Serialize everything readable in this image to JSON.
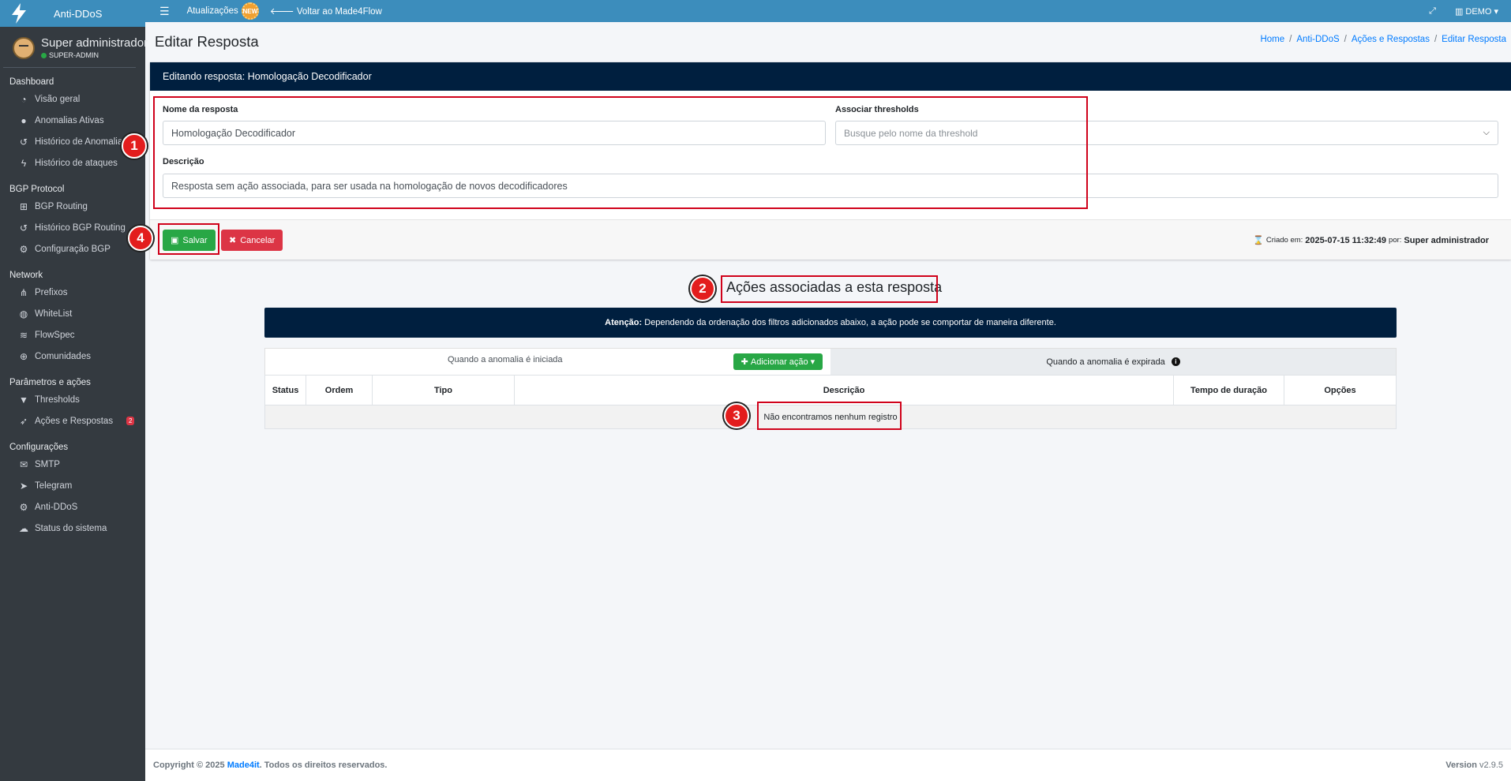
{
  "app": {
    "brand": "Anti-DDoS"
  },
  "user": {
    "name": "Super administrador",
    "role": "SUPER-ADMIN"
  },
  "sidebar": {
    "sections": [
      {
        "title": "Dashboard",
        "items": [
          {
            "label": "Visão geral",
            "icon": "dashboard-icon"
          },
          {
            "label": "Anomalias Ativas",
            "icon": "exclamation-icon"
          },
          {
            "label": "Histórico de Anomalias",
            "icon": "history-icon"
          },
          {
            "label": "Histórico de ataques",
            "icon": "bolt-icon"
          }
        ]
      },
      {
        "title": "BGP Protocol",
        "items": [
          {
            "label": "BGP Routing",
            "icon": "sitemap-icon"
          },
          {
            "label": "Histórico BGP Routing",
            "icon": "history-icon"
          },
          {
            "label": "Configuração BGP",
            "icon": "gear-icon"
          }
        ]
      },
      {
        "title": "Network",
        "items": [
          {
            "label": "Prefixos",
            "icon": "network-icon"
          },
          {
            "label": "WhiteList",
            "icon": "shield-icon"
          },
          {
            "label": "FlowSpec",
            "icon": "wifi-icon"
          },
          {
            "label": "Comunidades",
            "icon": "globe-icon"
          }
        ]
      },
      {
        "title": "Parâmetros e ações",
        "items": [
          {
            "label": "Thresholds",
            "icon": "filter-icon"
          },
          {
            "label": "Ações e Respostas",
            "icon": "rocket-icon",
            "badge": "2"
          }
        ]
      },
      {
        "title": "Configurações",
        "items": [
          {
            "label": "SMTP",
            "icon": "envelope-icon"
          },
          {
            "label": "Telegram",
            "icon": "telegram-icon"
          },
          {
            "label": "Anti-DDoS",
            "icon": "gears-icon"
          },
          {
            "label": "Status do sistema",
            "icon": "cloud-icon"
          }
        ]
      }
    ]
  },
  "topbar": {
    "updates_label": "Atualizações",
    "updates_badge": "NEW",
    "back_label": "Voltar ao Made4Flow",
    "company_label": "DEMO"
  },
  "header": {
    "title": "Editar Resposta",
    "breadcrumb": [
      "Home",
      "Anti-DDoS",
      "Ações e Respostas",
      "Editar Resposta"
    ]
  },
  "form": {
    "card_title": "Editando resposta: Homologação Decodificador",
    "name_label": "Nome da resposta",
    "name_value": "Homologação Decodificador",
    "thresholds_label": "Associar thresholds",
    "thresholds_placeholder": "Busque pelo nome da threshold",
    "description_label": "Descrição",
    "description_value": "Resposta sem ação associada, para ser usada na homologação de novos decodificadores",
    "save_label": "Salvar",
    "cancel_label": "Cancelar",
    "created_prefix": "Criado em:",
    "created_at": "2025-07-15 11:32:49",
    "created_by_prefix": "por:",
    "created_by": "Super administrador"
  },
  "actions": {
    "title": "Ações associadas a esta resposta",
    "alert_strong": "Atenção:",
    "alert_text": "Dependendo da ordenação dos filtros adicionados abaixo, a ação pode se comportar de maneira diferente.",
    "tab_started": "Quando a anomalia é iniciada",
    "tab_expired": "Quando a anomalia é expirada",
    "add_label": "Adicionar ação",
    "columns": [
      "Status",
      "Ordem",
      "Tipo",
      "Descrição",
      "Tempo de duração",
      "Opções"
    ],
    "empty_text": "Não encontramos nenhum registro"
  },
  "annotations": [
    "1",
    "2",
    "3",
    "4"
  ],
  "footer": {
    "copyright_prefix": "Copyright © 2025",
    "company": "Made4it",
    "copyright_suffix": ". Todos os direitos reservados.",
    "version_label": "Version",
    "version": "v2.9.5"
  }
}
